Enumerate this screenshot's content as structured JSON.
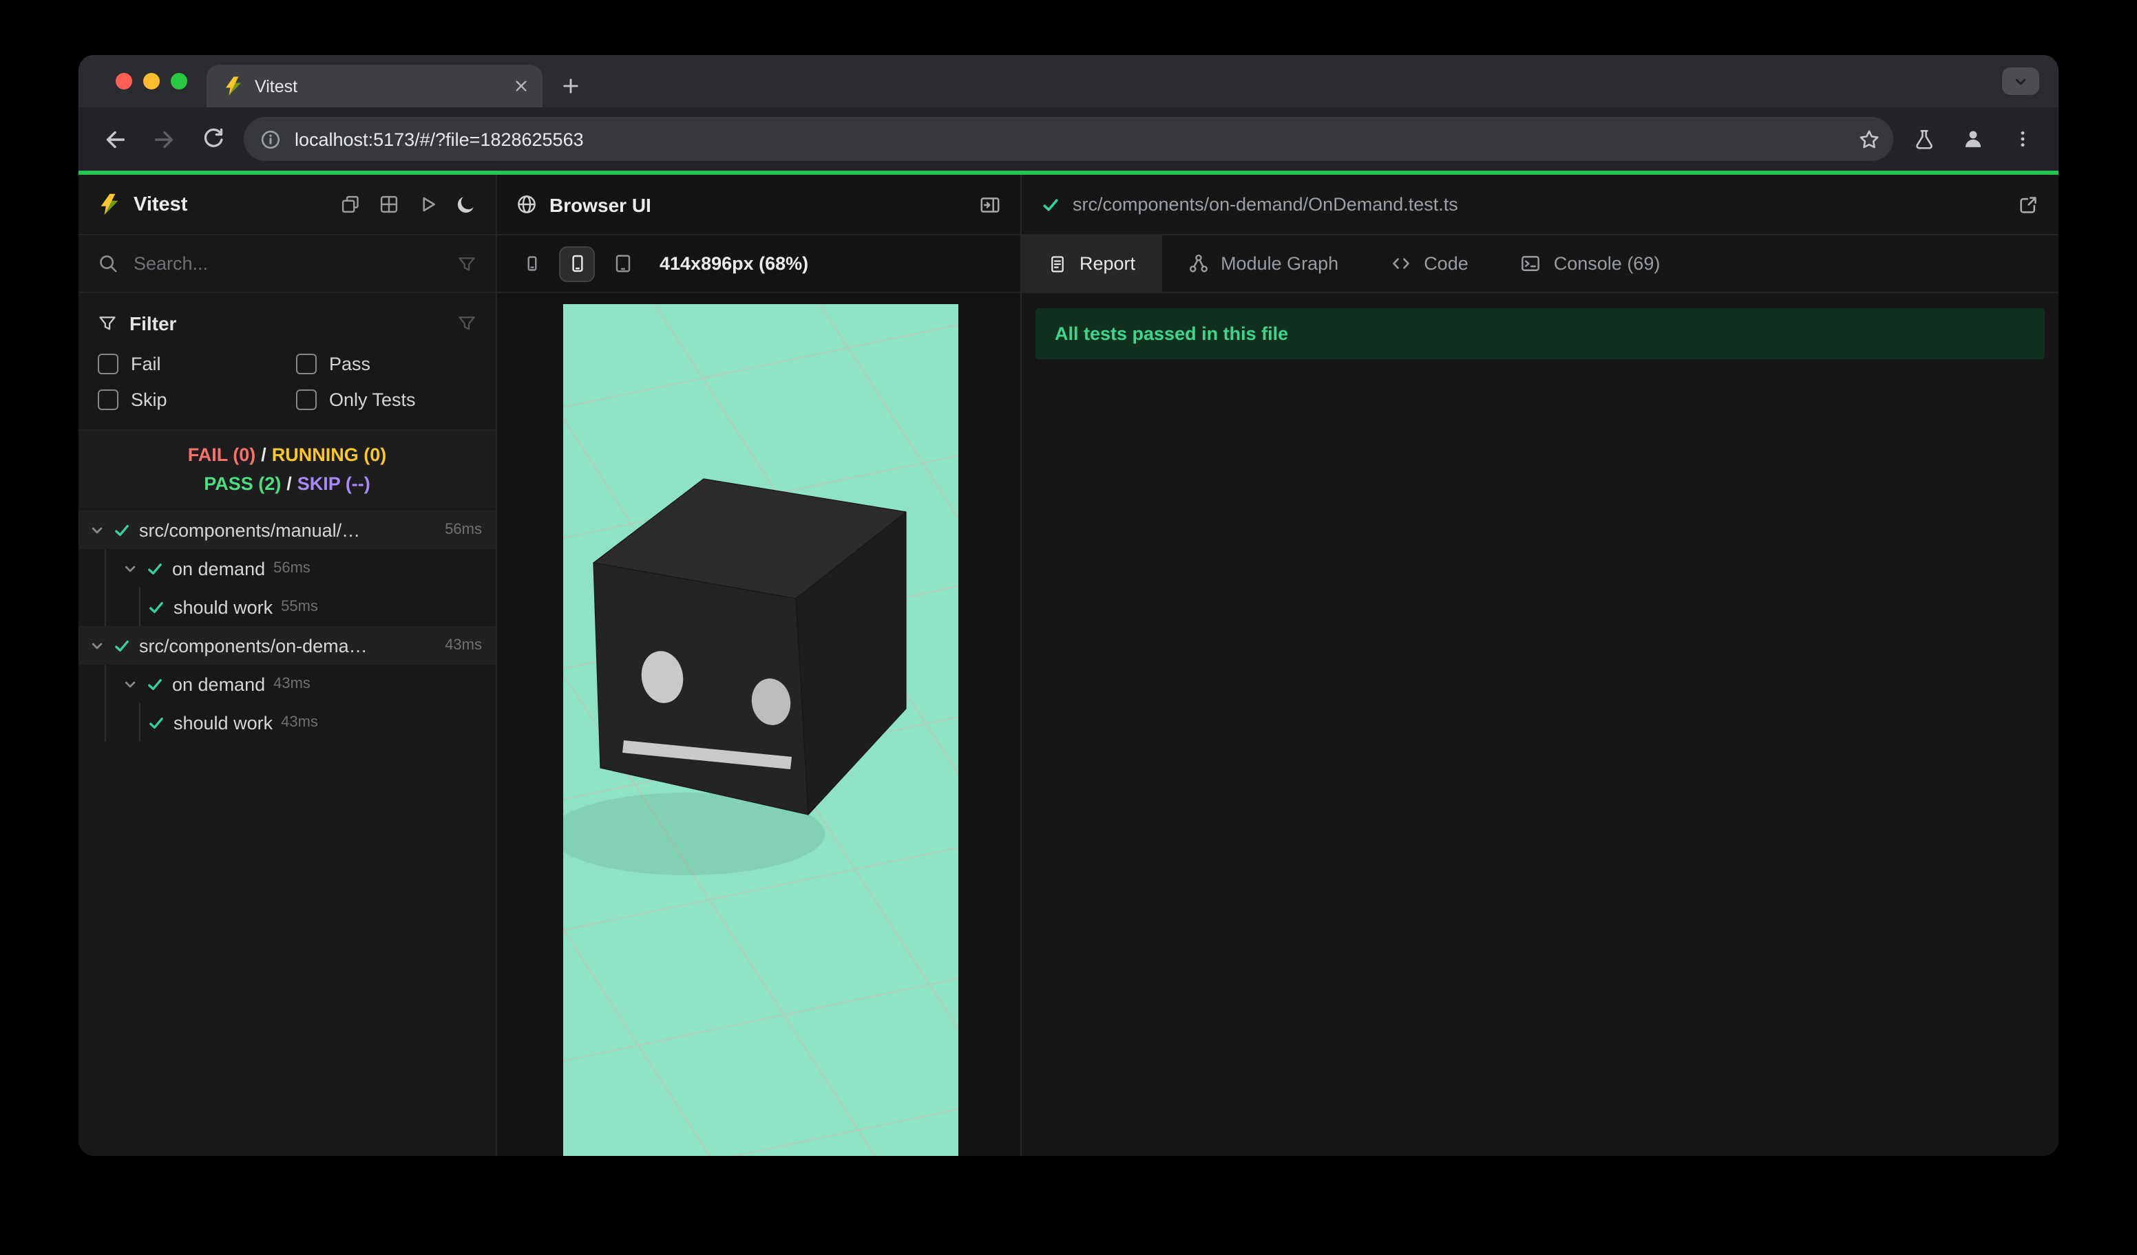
{
  "window": {
    "tab_title": "Vitest",
    "url": "localhost:5173/#/?file=1828625563"
  },
  "sidebar": {
    "app_name": "Vitest",
    "search_placeholder": "Search...",
    "filter": {
      "title": "Filter",
      "options": [
        "Fail",
        "Pass",
        "Skip",
        "Only Tests"
      ]
    },
    "status": {
      "fail": "FAIL (0)",
      "running": "RUNNING (0)",
      "pass": "PASS (2)",
      "skip": "SKIP (--)",
      "separator": "/"
    },
    "tree": [
      {
        "label": "src/components/manual/…",
        "time": "56ms"
      },
      {
        "label": "on demand",
        "time": "56ms"
      },
      {
        "label": "should work",
        "time": "55ms"
      },
      {
        "label": "src/components/on-dema…",
        "time": "43ms"
      },
      {
        "label": "on demand",
        "time": "43ms"
      },
      {
        "label": "should work",
        "time": "43ms"
      }
    ]
  },
  "browser_panel": {
    "title": "Browser UI",
    "viewport_label": "414x896px (68%)"
  },
  "report_panel": {
    "file_path": "src/components/on-demand/OnDemand.test.ts",
    "tabs": {
      "report": "Report",
      "module_graph": "Module Graph",
      "code": "Code",
      "console": "Console (69)"
    },
    "banner": "All tests passed in this file"
  },
  "colors": {
    "accent-green": "#23c552",
    "mint": "#8ee3c5",
    "fail": "#fb7169",
    "running": "#fcc72b",
    "pass": "#4ade80",
    "skip": "#a78bfa",
    "check": "#34d399",
    "banner-bg": "#11301f",
    "banner-text": "#3dd68c"
  }
}
